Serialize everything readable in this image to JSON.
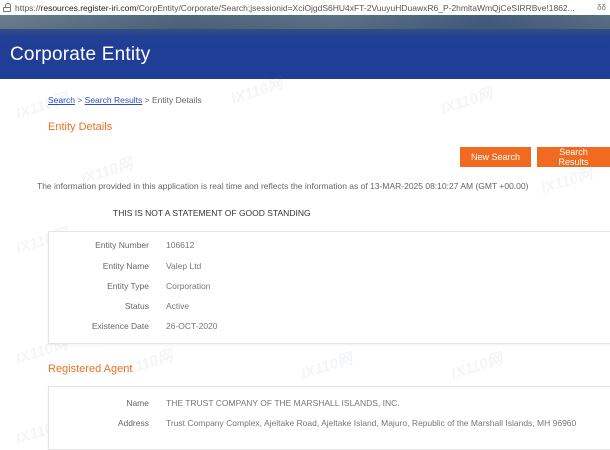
{
  "browser": {
    "url_prefix": "https://",
    "url_host": "resources.register-iri.com",
    "url_path": "/CorpEntity/Corporate/Search;jsessionid=XciOjgdS6HU4xFT-2VuuyuHDuawxR6_P-2hmltaWmQjCeSIRRBve!1862...",
    "ext_label": "δδ"
  },
  "header": {
    "title": "Corporate Entity"
  },
  "breadcrumb": {
    "search": "Search",
    "sep1": ">",
    "results": "Search Results",
    "sep2": "> Entity Details"
  },
  "entity_details": {
    "title": "Entity Details",
    "new_search_label": "New Search",
    "search_results_label": "Search Results",
    "info_text": "The information provided in this application is real time and reflects the information as of 13-MAR-2025 08:10:27 AM (GMT +00.00)",
    "notice": "THIS IS NOT A STATEMENT OF GOOD STANDING",
    "fields": [
      {
        "label": "Entity Number",
        "value": "106612"
      },
      {
        "label": "Entity Name",
        "value": "Valep Ltd"
      },
      {
        "label": "Entity Type",
        "value": "Corporation"
      },
      {
        "label": "Status",
        "value": "Active"
      },
      {
        "label": "Existence Date",
        "value": "26-OCT-2020"
      }
    ]
  },
  "registered_agent": {
    "title": "Registered Agent",
    "fields": [
      {
        "label": "Name",
        "value": "THE TRUST COMPANY OF THE MARSHALL ISLANDS, INC."
      },
      {
        "label": "Address",
        "value": "Trust Company Complex, Ajeltake Road, Ajeltake Island, Majuro, Republic of the Marshall Islands, MH 96960"
      }
    ]
  },
  "colors": {
    "accent": "#f06a1f",
    "title": "#e8702a",
    "banner": "#1f3d97",
    "link": "#2a52b8"
  }
}
